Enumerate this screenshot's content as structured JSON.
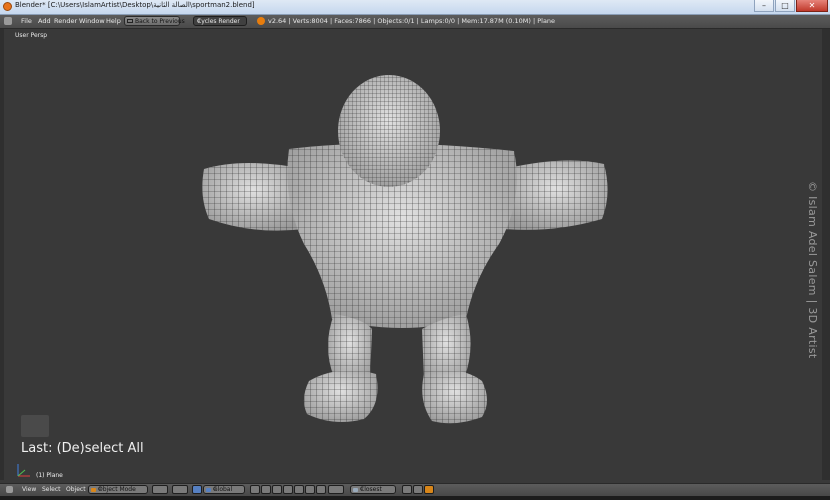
{
  "window": {
    "title": "Blender* [C:\\Users\\IslamArtist\\Desktop\\الصالة الثانية\\sportman2.blend]",
    "controls": {
      "minimize": "–",
      "maximize": "□",
      "close": "✕"
    }
  },
  "info_header": {
    "menus": [
      "File",
      "Add",
      "Render",
      "Window",
      "Help"
    ],
    "back_button": "Back to Previous",
    "render_engine": "Cycles Render",
    "stats": "v2.64 | Verts:8004 | Faces:7866 | Objects:0/1 | Lamps:0/0 | Mem:17.87M (0.10M) | Plane"
  },
  "viewport": {
    "view_label": "User Persp",
    "watermark": "© Islam Adel Salem | 3D Artist",
    "last_operator": "Last: (De)select All",
    "object_info": "(1) Plane"
  },
  "view3d_header": {
    "menus": [
      "View",
      "Select",
      "Object"
    ],
    "mode": "Object Mode",
    "orientation": "Global",
    "snap_target": "Closest"
  },
  "colors": {
    "viewport_bg": "#393939",
    "mesh_fill": "#cfcfcf",
    "wire": "#2a2a2a",
    "title_bar": "#c5d7ee",
    "accent_orange": "#e87d0d"
  }
}
